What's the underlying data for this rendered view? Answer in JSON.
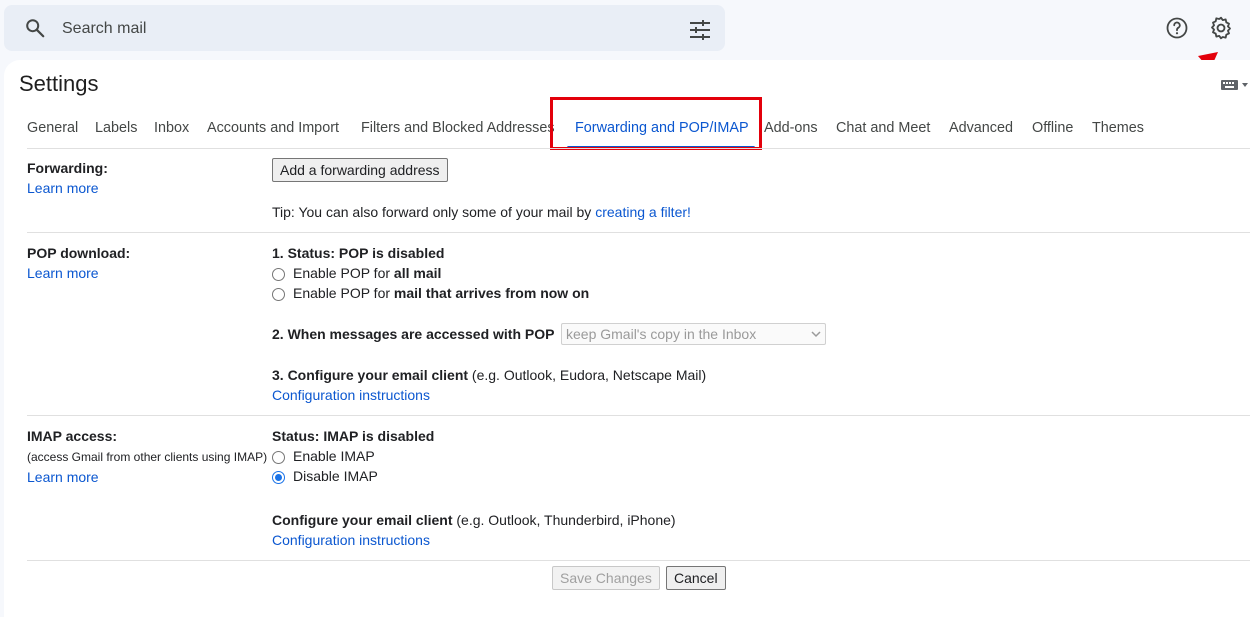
{
  "search": {
    "placeholder": "Search mail"
  },
  "icons": {
    "search": "search-icon",
    "tune": "tune-icon",
    "help": "help-icon",
    "settings": "gear-icon",
    "keyboard": "keyboard-icon",
    "annotation_arrow": "arrow-icon"
  },
  "colors": {
    "accent": "#0b57d0",
    "highlight": "#e3000b",
    "annotation_arrow": "#e3000b"
  },
  "page_title": "Settings",
  "tabs": [
    {
      "label": "General"
    },
    {
      "label": "Labels"
    },
    {
      "label": "Inbox"
    },
    {
      "label": "Accounts and Import"
    },
    {
      "label": "Filters and Blocked Addresses"
    },
    {
      "label": "Forwarding and POP/IMAP",
      "active": true
    },
    {
      "label": "Add-ons"
    },
    {
      "label": "Chat and Meet"
    },
    {
      "label": "Advanced"
    },
    {
      "label": "Offline"
    },
    {
      "label": "Themes"
    }
  ],
  "forwarding": {
    "label": "Forwarding:",
    "learn_more": "Learn more",
    "add_button": "Add a forwarding address",
    "tip_prefix": "Tip: You can also forward only some of your mail by ",
    "tip_link": "creating a filter!"
  },
  "pop": {
    "label": "POP download:",
    "learn_more": "Learn more",
    "status": "1. Status: POP is disabled",
    "option1_prefix": "Enable POP for ",
    "option1_bold": "all mail",
    "option2_prefix": "Enable POP for ",
    "option2_bold": "mail that arrives from now on",
    "step2_label": "2. When messages are accessed with POP",
    "step2_select": "keep Gmail's copy in the Inbox",
    "step3_bold": "3. Configure your email client",
    "step3_rest": " (e.g. Outlook, Eudora, Netscape Mail)",
    "config_link": "Configuration instructions"
  },
  "imap": {
    "label": "IMAP access:",
    "sublabel": "(access Gmail from other clients using IMAP)",
    "learn_more": "Learn more",
    "status": "Status: IMAP is disabled",
    "enable": "Enable IMAP",
    "disable": "Disable IMAP",
    "selected": "disable",
    "config_bold": "Configure your email client",
    "config_rest": " (e.g. Outlook, Thunderbird, iPhone)",
    "config_link": "Configuration instructions"
  },
  "footer": {
    "save": "Save Changes",
    "cancel": "Cancel"
  }
}
